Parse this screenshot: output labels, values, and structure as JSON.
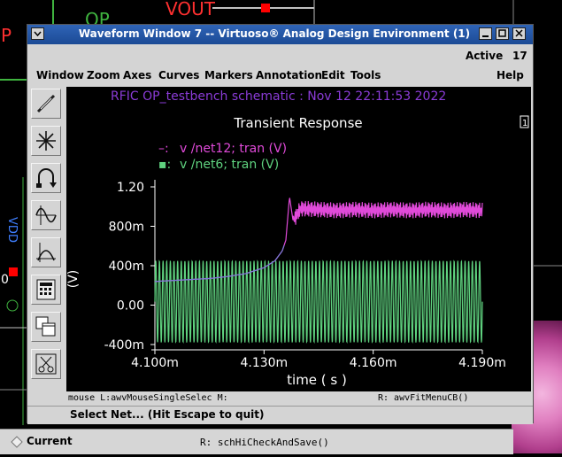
{
  "background": {
    "label_op": "OP",
    "label_vout": "VOUT",
    "label_p": "P",
    "label_vdd": "VDD",
    "label_zero": "0",
    "current_label": "Current",
    "cmd_history": "R:  schHiCheckAndSave()"
  },
  "window": {
    "title": "Waveform Window 7 -- Virtuoso® Analog Design Environment (1)",
    "status_left": "Active",
    "status_right": "17",
    "menus": [
      "Window",
      "Zoom",
      "Axes",
      "Curves",
      "Markers",
      "Annotation",
      "Edit",
      "Tools"
    ],
    "help_label": "Help",
    "title_buttons": [
      "menu",
      "minimize",
      "maximize",
      "close"
    ]
  },
  "toolbar": {
    "icons": [
      "zoom-pen-icon",
      "snowflake-icon",
      "loop-arrow-icon",
      "sine-icon",
      "parabola-icon",
      "calculator-icon",
      "window-copy-icon",
      "scissors-icon"
    ]
  },
  "plot": {
    "header": "RFIC OP_testbench schematic : Nov 12 22:11:53 2022",
    "subplot_marker": "1",
    "colors": {
      "background": "#000000",
      "header": "#8a3bd6",
      "title": "#ffffff",
      "series1": "#e04ad9",
      "series2": "#5fd27f",
      "axis": "#ffffff"
    }
  },
  "chart_data": {
    "type": "line",
    "title": "Transient Response",
    "xlabel": "time ( s )",
    "ylabel": "(V)",
    "xlim": [
      4.1,
      4.19
    ],
    "ylim": [
      -0.4,
      1.2
    ],
    "x_unit": "ms",
    "x_ticks": [
      "4.100m",
      "4.130m",
      "4.160m",
      "4.190m"
    ],
    "y_ticks": [
      "1.20",
      "800m",
      "400m",
      "0.00",
      "-400m"
    ],
    "legend_position": "top-left",
    "series": [
      {
        "name": "v /net12; tran (V)",
        "marker": "–:",
        "color": "#e04ad9",
        "points": [
          [
            4.1,
            0.24
          ],
          [
            4.105,
            0.25
          ],
          [
            4.11,
            0.26
          ],
          [
            4.115,
            0.27
          ],
          [
            4.12,
            0.29
          ],
          [
            4.125,
            0.32
          ],
          [
            4.13,
            0.38
          ],
          [
            4.133,
            0.45
          ],
          [
            4.135,
            0.55
          ],
          [
            4.136,
            0.66
          ],
          [
            4.137,
            1.1
          ],
          [
            4.138,
            0.85
          ],
          [
            4.14,
            0.98
          ],
          [
            4.145,
            0.97
          ],
          [
            4.15,
            0.96
          ],
          [
            4.155,
            0.97
          ],
          [
            4.16,
            0.96
          ],
          [
            4.165,
            0.97
          ],
          [
            4.17,
            0.96
          ],
          [
            4.175,
            0.97
          ],
          [
            4.18,
            0.96
          ],
          [
            4.185,
            0.97
          ],
          [
            4.19,
            0.96
          ]
        ],
        "ripple_amplitude": 0.08
      },
      {
        "name": "v /net6; tran (V)",
        "marker": "▪:",
        "color": "#5fd27f",
        "min": -0.38,
        "max": 0.45,
        "cycles": 90
      }
    ]
  },
  "statusline": {
    "mouse": "mouse L:awvMouseSingleSelec M:",
    "right": "R: awvFitMenuCB()"
  },
  "prompt": "Select Net... (Hit Escape to quit)"
}
